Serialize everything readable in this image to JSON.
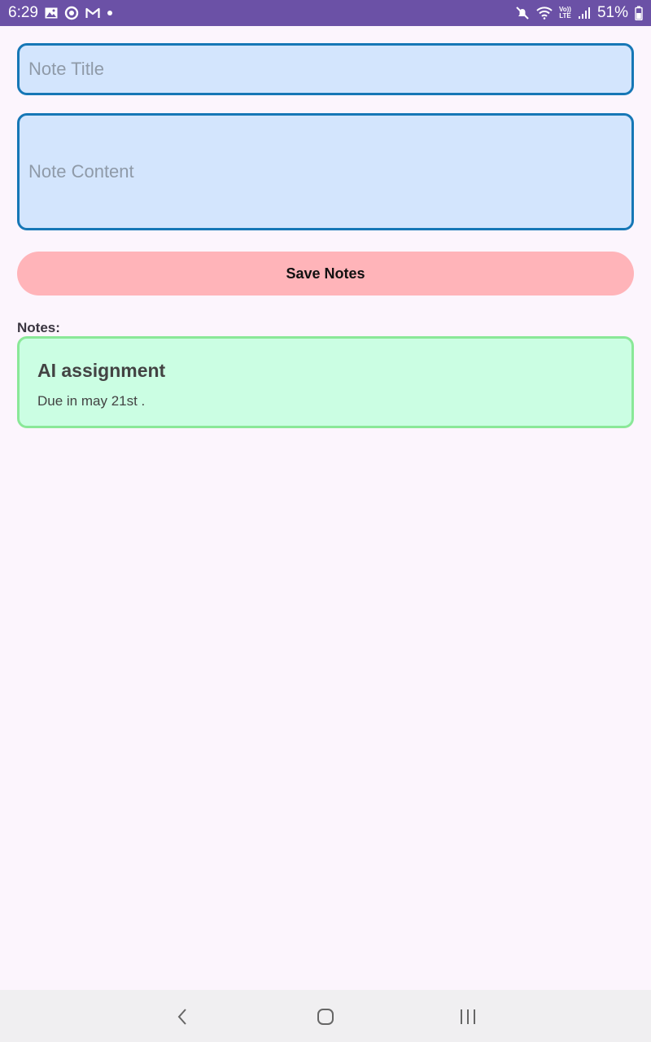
{
  "status_bar": {
    "time": "6:29",
    "battery_percent": "51%",
    "icons": [
      "gallery-icon",
      "sync-icon",
      "gmail-icon",
      "dot-icon",
      "mute-icon",
      "wifi-icon",
      "volte-lte-icon",
      "signal-icon",
      "battery-icon"
    ],
    "volte_label": "Vo))",
    "lte_label": "LTE"
  },
  "form": {
    "title_placeholder": "Note Title",
    "title_value": "",
    "content_placeholder": "Note Content",
    "content_value": "",
    "save_label": "Save Notes"
  },
  "notes": {
    "label": "Notes:",
    "items": [
      {
        "title": "AI assignment",
        "content": "Due in may 21st ."
      }
    ]
  },
  "nav_bar": {
    "icons": [
      "back-icon",
      "home-icon",
      "recents-icon"
    ]
  },
  "colors": {
    "status_bar": "#6b51a6",
    "field_bg": "#d3e5fd",
    "field_border": "#1677b6",
    "save_button": "#ffb4b9",
    "note_card_bg": "#cbfee3",
    "note_card_border": "#8ae898",
    "page_bg": "#fcf5fd"
  }
}
